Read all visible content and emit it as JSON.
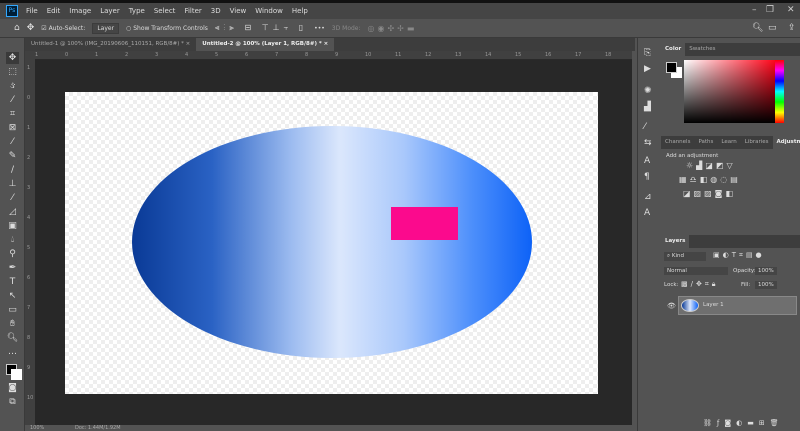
{
  "menu": {
    "items": [
      "File",
      "Edit",
      "Image",
      "Layer",
      "Type",
      "Select",
      "Filter",
      "3D",
      "View",
      "Window",
      "Help"
    ],
    "logo": "Ps"
  },
  "options": {
    "auto_select_label": "Auto-Select:",
    "auto_select_value": "Layer",
    "transform_label": "Show Transform Controls",
    "mode_3d": "3D Mode:"
  },
  "tabs": [
    {
      "label": "Untitled-1 @ 100% (IMG_20190606_110151, RGB/8#) *"
    },
    {
      "label": "Untitled-2 @ 100% (Layer 1, RGB/8#) *"
    }
  ],
  "ruler": {
    "h": [
      "1",
      "0",
      "1",
      "2",
      "3",
      "4",
      "5",
      "6",
      "7",
      "8",
      "9",
      "10",
      "11",
      "12",
      "13",
      "14",
      "15",
      "16",
      "17",
      "18"
    ],
    "v": [
      "1",
      "0",
      "1",
      "2",
      "3",
      "4",
      "5",
      "6",
      "7",
      "8",
      "9",
      "10"
    ]
  },
  "status": {
    "zoom": "100%",
    "doc": "Doc: 1.44M/1.92M"
  },
  "color_panel": {
    "tabs": [
      "Color",
      "Swatches"
    ],
    "foreground": "#000000",
    "background": "#ffffff"
  },
  "adjust_panel": {
    "tabs": [
      "Channels",
      "Paths",
      "Learn",
      "Libraries",
      "Adjustments"
    ],
    "hint": "Add an adjustment"
  },
  "layers_panel": {
    "tab": "Layers",
    "filter": "Kind",
    "blend_mode": "Normal",
    "opacity_label": "Opacity:",
    "opacity": "100%",
    "lock_label": "Lock:",
    "fill_label": "Fill:",
    "fill": "100%",
    "layers": [
      {
        "name": "Layer 1",
        "visible": true
      }
    ]
  },
  "colors": {
    "pink": "#fb0a8d",
    "gradient_dark": "#0a3a96",
    "gradient_light": "#dbe7fc",
    "gradient_right": "#0d62f7"
  }
}
